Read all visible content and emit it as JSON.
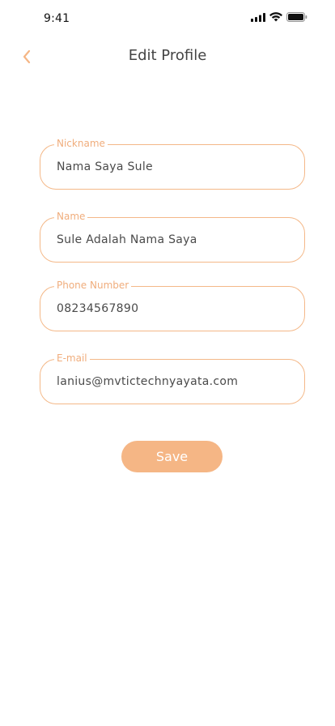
{
  "status_bar": {
    "time": "9:41"
  },
  "header": {
    "title": "Edit Profile",
    "back_icon": "chevron-left-icon"
  },
  "form": {
    "fields": [
      {
        "label": "Nickname",
        "value": "Nama Saya Sule"
      },
      {
        "label": "Name",
        "value": "Sule Adalah Nama Saya"
      },
      {
        "label": "Phone Number",
        "value": "08234567890"
      },
      {
        "label": "E-mail",
        "value": "lanius@mvtictechnyayata.com"
      }
    ],
    "save_label": "Save"
  },
  "colors": {
    "accent": "#f5b685",
    "field_border": "#f4b888",
    "label": "#f0ad7c",
    "title": "#444444",
    "text": "#4a4a4a"
  }
}
